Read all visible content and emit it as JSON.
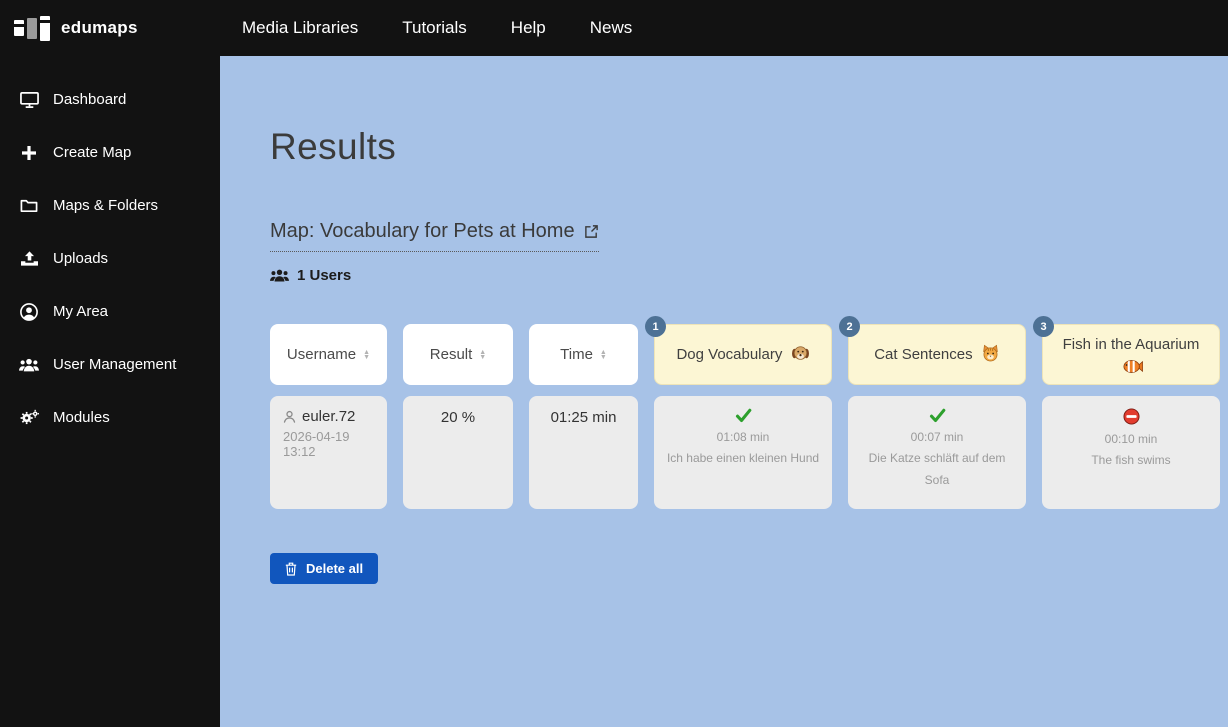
{
  "brand": {
    "name": "edumaps"
  },
  "topnav": {
    "items": [
      {
        "label": "Media Libraries"
      },
      {
        "label": "Tutorials"
      },
      {
        "label": "Help"
      },
      {
        "label": "News"
      }
    ]
  },
  "sidebar": {
    "items": [
      {
        "label": "Dashboard",
        "icon": "dashboard-icon"
      },
      {
        "label": "Create Map",
        "icon": "plus-icon"
      },
      {
        "label": "Maps & Folders",
        "icon": "folder-icon"
      },
      {
        "label": "Uploads",
        "icon": "upload-icon"
      },
      {
        "label": "My Area",
        "icon": "user-circle-icon"
      },
      {
        "label": "User Management",
        "icon": "users-icon"
      },
      {
        "label": "Modules",
        "icon": "cogs-icon"
      }
    ]
  },
  "main": {
    "title": "Results",
    "map_link": {
      "label": "Map: Vocabulary for Pets at Home",
      "icon": "external-link-icon"
    },
    "users_summary": "1 Users",
    "table": {
      "sort_glyph_up": "▲",
      "sort_glyph_down": "▼",
      "sort_columns": [
        {
          "label": "Username"
        },
        {
          "label": "Result"
        },
        {
          "label": "Time"
        }
      ],
      "task_columns": [
        {
          "number": "1",
          "label": "Dog Vocabulary",
          "emoji": "🐶",
          "icon": "dog-emoji-icon"
        },
        {
          "number": "2",
          "label": "Cat Sentences",
          "emoji": "🐱",
          "icon": "cat-emoji-icon"
        },
        {
          "number": "3",
          "label": "Fish in the Aquarium",
          "emoji": "🐠",
          "icon": "fish-emoji-icon"
        }
      ],
      "row": {
        "username": "euler.72",
        "date": "2026-04-19 13:12",
        "result": "20 %",
        "time": "01:25 min",
        "tasks": [
          {
            "status": "correct",
            "icon": "check-icon",
            "time": "01:08 min",
            "answer": "Ich habe einen kleinen Hund"
          },
          {
            "status": "correct",
            "icon": "check-icon",
            "time": "00:07 min",
            "answer": "Die Katze schläft auf dem Sofa"
          },
          {
            "status": "wrong",
            "icon": "no-entry-icon",
            "time": "00:10 min",
            "answer": "The fish swims"
          }
        ]
      }
    },
    "delete_button": {
      "label": "Delete all",
      "icon": "trash-icon"
    }
  },
  "colors": {
    "navbar_bg": "#121212",
    "sidebar_bg": "#121212",
    "content_bg": "#a7c2e7",
    "header_cell_bg": "#ffffff",
    "task_header_bg": "#fcf6d4",
    "data_cell_bg": "#ececec",
    "badge_bg": "#4d7195",
    "button_bg": "#1156bd",
    "correct_green": "#2da02d",
    "wrong_red": "#e23c2e"
  }
}
